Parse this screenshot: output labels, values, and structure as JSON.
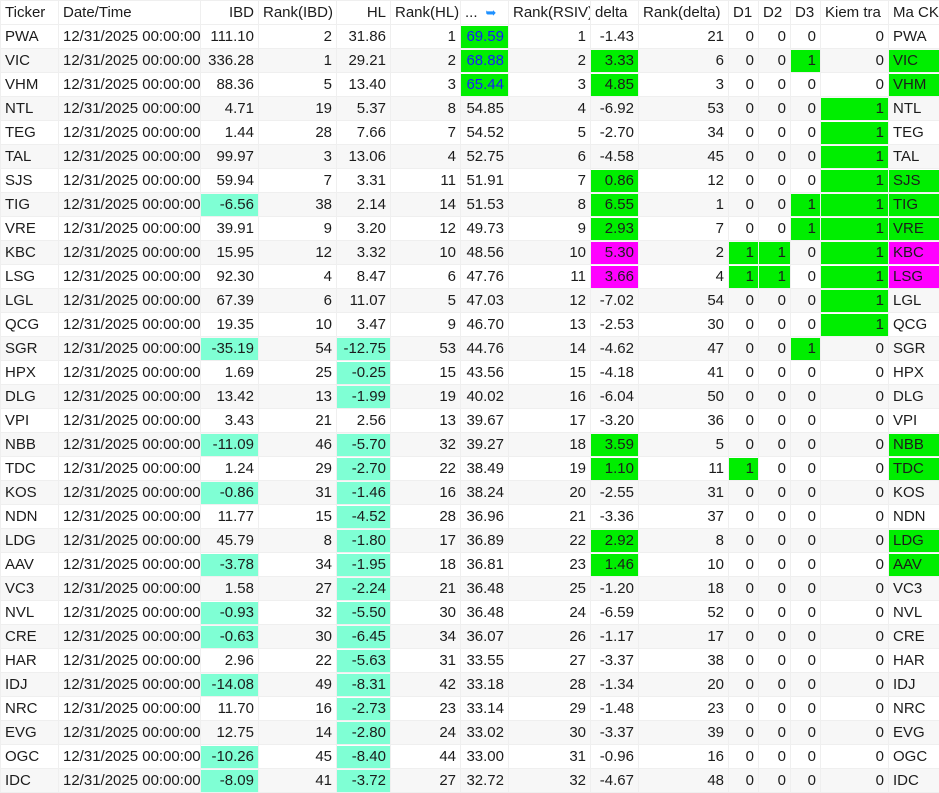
{
  "columns": [
    "Ticker",
    "Date/Time",
    "IBD",
    "Rank(IBD)",
    "HL",
    "Rank(HL)",
    "...",
    "Rank(RSIV)",
    "delta",
    "Rank(delta)",
    "D1",
    "D2",
    "D3",
    "Kiem tra",
    "Ma CK"
  ],
  "sort_icon": "sort-descending-arrow-icon",
  "colors": {
    "green": "#00ee00",
    "teal": "#7fffd4",
    "magenta": "#ff00ff",
    "blue_text": "#1a1aff"
  },
  "rows": [
    {
      "cells": [
        "PWA",
        "12/31/2025 00:00:00",
        "111.10",
        "2",
        "31.86",
        "1",
        "69.59",
        "1",
        "-1.43",
        "21",
        "0",
        "0",
        "0",
        "0",
        "PWA"
      ],
      "hl": {
        "6": "green"
      }
    },
    {
      "cells": [
        "VIC",
        "12/31/2025 00:00:00",
        "336.28",
        "1",
        "29.21",
        "2",
        "68.88",
        "2",
        "3.33",
        "6",
        "0",
        "0",
        "1",
        "0",
        "VIC"
      ],
      "hl": {
        "6": "green",
        "8": "green",
        "12": "green",
        "14": "green"
      }
    },
    {
      "cells": [
        "VHM",
        "12/31/2025 00:00:00",
        "88.36",
        "5",
        "13.40",
        "3",
        "65.44",
        "3",
        "4.85",
        "3",
        "0",
        "0",
        "0",
        "0",
        "VHM"
      ],
      "hl": {
        "6": "green",
        "8": "green",
        "14": "green"
      }
    },
    {
      "cells": [
        "NTL",
        "12/31/2025 00:00:00",
        "4.71",
        "19",
        "5.37",
        "8",
        "54.85",
        "4",
        "-6.92",
        "53",
        "0",
        "0",
        "0",
        "1",
        "NTL"
      ],
      "hl": {
        "13": "green"
      }
    },
    {
      "cells": [
        "TEG",
        "12/31/2025 00:00:00",
        "1.44",
        "28",
        "7.66",
        "7",
        "54.52",
        "5",
        "-2.70",
        "34",
        "0",
        "0",
        "0",
        "1",
        "TEG"
      ],
      "hl": {
        "13": "green"
      }
    },
    {
      "cells": [
        "TAL",
        "12/31/2025 00:00:00",
        "99.97",
        "3",
        "13.06",
        "4",
        "52.75",
        "6",
        "-4.58",
        "45",
        "0",
        "0",
        "0",
        "1",
        "TAL"
      ],
      "hl": {
        "13": "green"
      }
    },
    {
      "cells": [
        "SJS",
        "12/31/2025 00:00:00",
        "59.94",
        "7",
        "3.31",
        "11",
        "51.91",
        "7",
        "0.86",
        "12",
        "0",
        "0",
        "0",
        "1",
        "SJS"
      ],
      "hl": {
        "8": "green",
        "13": "green",
        "14": "green"
      }
    },
    {
      "cells": [
        "TIG",
        "12/31/2025 00:00:00",
        "-6.56",
        "38",
        "2.14",
        "14",
        "51.53",
        "8",
        "6.55",
        "1",
        "0",
        "0",
        "1",
        "1",
        "TIG"
      ],
      "hl": {
        "2": "teal",
        "8": "green",
        "12": "green",
        "13": "green",
        "14": "green"
      }
    },
    {
      "cells": [
        "VRE",
        "12/31/2025 00:00:00",
        "39.91",
        "9",
        "3.20",
        "12",
        "49.73",
        "9",
        "2.93",
        "7",
        "0",
        "0",
        "1",
        "1",
        "VRE"
      ],
      "hl": {
        "8": "green",
        "12": "green",
        "13": "green",
        "14": "green"
      }
    },
    {
      "cells": [
        "KBC",
        "12/31/2025 00:00:00",
        "15.95",
        "12",
        "3.32",
        "10",
        "48.56",
        "10",
        "5.30",
        "2",
        "1",
        "1",
        "0",
        "1",
        "KBC"
      ],
      "hl": {
        "8": "magenta",
        "10": "green",
        "11": "green",
        "13": "green",
        "14": "magenta"
      }
    },
    {
      "cells": [
        "LSG",
        "12/31/2025 00:00:00",
        "92.30",
        "4",
        "8.47",
        "6",
        "47.76",
        "11",
        "3.66",
        "4",
        "1",
        "1",
        "0",
        "1",
        "LSG"
      ],
      "hl": {
        "8": "magenta",
        "10": "green",
        "11": "green",
        "13": "green",
        "14": "magenta"
      }
    },
    {
      "cells": [
        "LGL",
        "12/31/2025 00:00:00",
        "67.39",
        "6",
        "11.07",
        "5",
        "47.03",
        "12",
        "-7.02",
        "54",
        "0",
        "0",
        "0",
        "1",
        "LGL"
      ],
      "hl": {
        "13": "green"
      }
    },
    {
      "cells": [
        "QCG",
        "12/31/2025 00:00:00",
        "19.35",
        "10",
        "3.47",
        "9",
        "46.70",
        "13",
        "-2.53",
        "30",
        "0",
        "0",
        "0",
        "1",
        "QCG"
      ],
      "hl": {
        "13": "green"
      }
    },
    {
      "cells": [
        "SGR",
        "12/31/2025 00:00:00",
        "-35.19",
        "54",
        "-12.75",
        "53",
        "44.76",
        "14",
        "-4.62",
        "47",
        "0",
        "0",
        "1",
        "0",
        "SGR"
      ],
      "hl": {
        "2": "teal",
        "4": "teal",
        "12": "green"
      }
    },
    {
      "cells": [
        "HPX",
        "12/31/2025 00:00:00",
        "1.69",
        "25",
        "-0.25",
        "15",
        "43.56",
        "15",
        "-4.18",
        "41",
        "0",
        "0",
        "0",
        "0",
        "HPX"
      ],
      "hl": {
        "4": "teal"
      }
    },
    {
      "cells": [
        "DLG",
        "12/31/2025 00:00:00",
        "13.42",
        "13",
        "-1.99",
        "19",
        "40.02",
        "16",
        "-6.04",
        "50",
        "0",
        "0",
        "0",
        "0",
        "DLG"
      ],
      "hl": {
        "4": "teal"
      }
    },
    {
      "cells": [
        "VPI",
        "12/31/2025 00:00:00",
        "3.43",
        "21",
        "2.56",
        "13",
        "39.67",
        "17",
        "-3.20",
        "36",
        "0",
        "0",
        "0",
        "0",
        "VPI"
      ],
      "hl": {}
    },
    {
      "cells": [
        "NBB",
        "12/31/2025 00:00:00",
        "-11.09",
        "46",
        "-5.70",
        "32",
        "39.27",
        "18",
        "3.59",
        "5",
        "0",
        "0",
        "0",
        "0",
        "NBB"
      ],
      "hl": {
        "2": "teal",
        "4": "teal",
        "8": "green",
        "14": "green"
      }
    },
    {
      "cells": [
        "TDC",
        "12/31/2025 00:00:00",
        "1.24",
        "29",
        "-2.70",
        "22",
        "38.49",
        "19",
        "1.10",
        "11",
        "1",
        "0",
        "0",
        "0",
        "TDC"
      ],
      "hl": {
        "4": "teal",
        "8": "green",
        "10": "green",
        "14": "green"
      }
    },
    {
      "cells": [
        "KOS",
        "12/31/2025 00:00:00",
        "-0.86",
        "31",
        "-1.46",
        "16",
        "38.24",
        "20",
        "-2.55",
        "31",
        "0",
        "0",
        "0",
        "0",
        "KOS"
      ],
      "hl": {
        "2": "teal",
        "4": "teal"
      }
    },
    {
      "cells": [
        "NDN",
        "12/31/2025 00:00:00",
        "11.77",
        "15",
        "-4.52",
        "28",
        "36.96",
        "21",
        "-3.36",
        "37",
        "0",
        "0",
        "0",
        "0",
        "NDN"
      ],
      "hl": {
        "4": "teal"
      }
    },
    {
      "cells": [
        "LDG",
        "12/31/2025 00:00:00",
        "45.79",
        "8",
        "-1.80",
        "17",
        "36.89",
        "22",
        "2.92",
        "8",
        "0",
        "0",
        "0",
        "0",
        "LDG"
      ],
      "hl": {
        "4": "teal",
        "8": "green",
        "14": "green"
      }
    },
    {
      "cells": [
        "AAV",
        "12/31/2025 00:00:00",
        "-3.78",
        "34",
        "-1.95",
        "18",
        "36.81",
        "23",
        "1.46",
        "10",
        "0",
        "0",
        "0",
        "0",
        "AAV"
      ],
      "hl": {
        "2": "teal",
        "4": "teal",
        "8": "green",
        "14": "green"
      }
    },
    {
      "cells": [
        "VC3",
        "12/31/2025 00:00:00",
        "1.58",
        "27",
        "-2.24",
        "21",
        "36.48",
        "25",
        "-1.20",
        "18",
        "0",
        "0",
        "0",
        "0",
        "VC3"
      ],
      "hl": {
        "4": "teal"
      }
    },
    {
      "cells": [
        "NVL",
        "12/31/2025 00:00:00",
        "-0.93",
        "32",
        "-5.50",
        "30",
        "36.48",
        "24",
        "-6.59",
        "52",
        "0",
        "0",
        "0",
        "0",
        "NVL"
      ],
      "hl": {
        "2": "teal",
        "4": "teal"
      }
    },
    {
      "cells": [
        "CRE",
        "12/31/2025 00:00:00",
        "-0.63",
        "30",
        "-6.45",
        "34",
        "36.07",
        "26",
        "-1.17",
        "17",
        "0",
        "0",
        "0",
        "0",
        "CRE"
      ],
      "hl": {
        "2": "teal",
        "4": "teal"
      }
    },
    {
      "cells": [
        "HAR",
        "12/31/2025 00:00:00",
        "2.96",
        "22",
        "-5.63",
        "31",
        "33.55",
        "27",
        "-3.37",
        "38",
        "0",
        "0",
        "0",
        "0",
        "HAR"
      ],
      "hl": {
        "4": "teal"
      }
    },
    {
      "cells": [
        "IDJ",
        "12/31/2025 00:00:00",
        "-14.08",
        "49",
        "-8.31",
        "42",
        "33.18",
        "28",
        "-1.34",
        "20",
        "0",
        "0",
        "0",
        "0",
        "IDJ"
      ],
      "hl": {
        "2": "teal",
        "4": "teal"
      }
    },
    {
      "cells": [
        "NRC",
        "12/31/2025 00:00:00",
        "11.70",
        "16",
        "-2.73",
        "23",
        "33.14",
        "29",
        "-1.48",
        "23",
        "0",
        "0",
        "0",
        "0",
        "NRC"
      ],
      "hl": {
        "4": "teal"
      }
    },
    {
      "cells": [
        "EVG",
        "12/31/2025 00:00:00",
        "12.75",
        "14",
        "-2.80",
        "24",
        "33.02",
        "30",
        "-3.37",
        "39",
        "0",
        "0",
        "0",
        "0",
        "EVG"
      ],
      "hl": {
        "4": "teal"
      }
    },
    {
      "cells": [
        "OGC",
        "12/31/2025 00:00:00",
        "-10.26",
        "45",
        "-8.40",
        "44",
        "33.00",
        "31",
        "-0.96",
        "16",
        "0",
        "0",
        "0",
        "0",
        "OGC"
      ],
      "hl": {
        "2": "teal",
        "4": "teal"
      }
    },
    {
      "cells": [
        "IDC",
        "12/31/2025 00:00:00",
        "-8.09",
        "41",
        "-3.72",
        "27",
        "32.72",
        "32",
        "-4.67",
        "48",
        "0",
        "0",
        "0",
        "0",
        "IDC"
      ],
      "hl": {
        "2": "teal",
        "4": "teal"
      }
    }
  ]
}
